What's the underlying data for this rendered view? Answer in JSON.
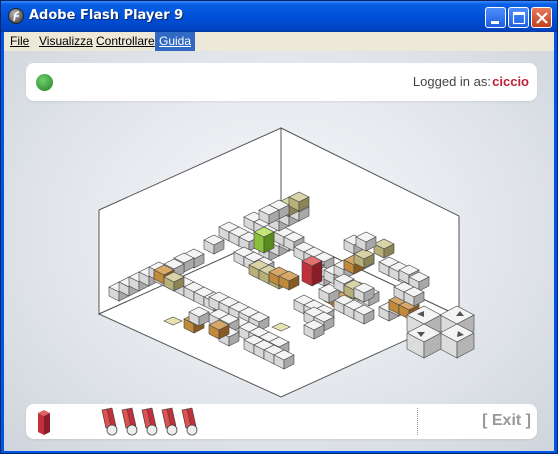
{
  "window": {
    "title": "Adobe Flash Player 9",
    "controls": [
      "minimize-icon",
      "maximize-icon",
      "close-icon"
    ]
  },
  "menu": {
    "items": [
      {
        "label": "File",
        "active": false
      },
      {
        "label": "Visualizza",
        "active": false
      },
      {
        "label": "Controllare",
        "active": false
      },
      {
        "label": "Guida",
        "active": true
      }
    ]
  },
  "game": {
    "status": {
      "icon": "status-dot-icon",
      "color": "#3fa53f"
    },
    "login": {
      "label": "Logged in as:",
      "username": "ciccio",
      "username_color": "#c0203a"
    },
    "lives_icon": "red-block-icon",
    "bullets": {
      "icon": "red-bullet-icon",
      "count": 5
    },
    "exit_label": "[ Exit ]",
    "dpad": {
      "buttons": [
        "up-arrow-icon",
        "right-arrow-icon",
        "left-arrow-icon",
        "down-arrow-icon"
      ]
    },
    "colors": {
      "player": "#c0303a",
      "goal": "#8ac13a",
      "crate": "#c08a3a",
      "pad": "#b7b07a"
    }
  }
}
